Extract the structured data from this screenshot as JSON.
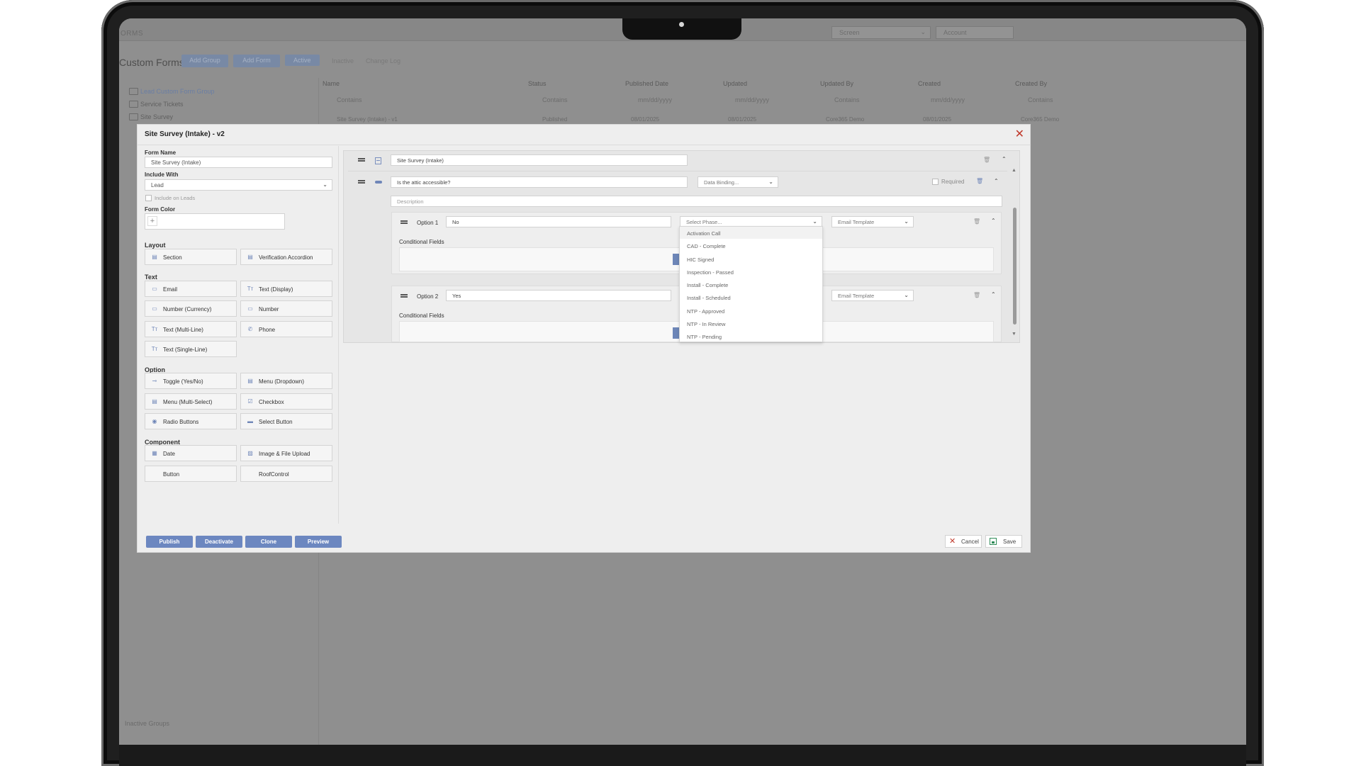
{
  "background": {
    "brand": "ORMS",
    "screen_select": "Screen",
    "account": "Account",
    "page_title": "Custom Forms",
    "buttons": [
      "Add Group",
      "Add Form"
    ],
    "tabs": [
      "Active",
      "Inactive",
      "Change Log"
    ],
    "sidebar": [
      "Lead Custom Form Group",
      "Service Tickets",
      "Site Survey"
    ],
    "columns": [
      "Name",
      "Status",
      "Published Date",
      "Updated",
      "Updated By",
      "Created",
      "Created By"
    ],
    "filters": [
      "Contains",
      "Contains",
      "mm/dd/yyyy",
      "mm/dd/yyyy",
      "Contains",
      "mm/dd/yyyy",
      "Contains"
    ],
    "row_name": "Site Survey (Intake) - v1",
    "row_status": "Published",
    "row_published": "08/01/2025",
    "row_updated": "08/01/2025",
    "row_updated_by": "Core365 Demo",
    "row_created": "08/01/2025",
    "row_created_by": "Core365 Demo",
    "inactive_groups": "Inactive Groups"
  },
  "modal": {
    "title": "Site Survey (Intake) - v2",
    "form_name_label": "Form Name",
    "form_name_value": "Site Survey (Intake)",
    "include_with_label": "Include With",
    "include_with_value": "Lead",
    "include_on_leads": "Include on Leads",
    "form_color_label": "Form Color",
    "layout_label": "Layout",
    "text_label": "Text",
    "option_label": "Option",
    "component_label": "Component",
    "layout_tiles": [
      "Section",
      "Verification Accordion"
    ],
    "text_tiles": [
      "Email",
      "Text (Display)",
      "Number (Currency)",
      "Number",
      "Text (Multi-Line)",
      "Phone",
      "Text (Single-Line)"
    ],
    "option_tiles": [
      "Toggle (Yes/No)",
      "Menu (Dropdown)",
      "Menu (Multi-Select)",
      "Checkbox",
      "Radio Buttons",
      "Select Button"
    ],
    "component_tiles": [
      "Date",
      "Image & File Upload",
      "Button",
      "RoofControl"
    ]
  },
  "builder": {
    "section_name": "Site Survey (Intake)",
    "question": "Is the attic accessible?",
    "data_binding": "Data Binding...",
    "required": "Required",
    "description": "Description",
    "option1_label": "Option 1",
    "option1_value": "No",
    "option2_label": "Option 2",
    "option2_value": "Yes",
    "select_phase": "Select Phase...",
    "email_template": "Email Template",
    "conditional_fields": "Conditional Fields"
  },
  "dropdown": {
    "items": [
      "Activation Call",
      "CAD - Complete",
      "HIC Signed",
      "Inspection - Passed",
      "Install - Complete",
      "Install - Scheduled",
      "NTP - Approved",
      "NTP - In Review",
      "NTP - Pending"
    ]
  },
  "footer": {
    "publish": "Publish",
    "deactivate": "Deactivate",
    "clone": "Clone",
    "preview": "Preview",
    "cancel": "Cancel",
    "save": "Save"
  }
}
